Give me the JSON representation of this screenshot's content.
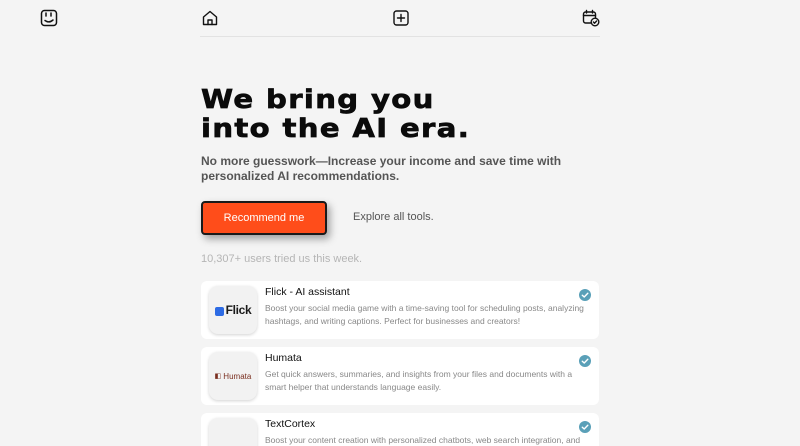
{
  "nav": {
    "logo_icon": "face-logo-icon",
    "items": [
      {
        "icon": "home-icon"
      },
      {
        "icon": "plus-square-icon"
      },
      {
        "icon": "calendar-check-icon"
      }
    ]
  },
  "hero": {
    "headline_line1": "We bring you",
    "headline_line2": "into the AI era.",
    "subheadline": "No more guesswork—Increase your income and save time with personalized AI recommendations.",
    "cta_label": "Recommend me",
    "explore_label": "Explore all tools.",
    "users_note": "10,307+ users tried us this week."
  },
  "tools": [
    {
      "name": "Flick - AI assistant",
      "logo_text": "Flick",
      "description": "Boost your social media game with a time-saving tool for scheduling posts, analyzing hashtags, and writing captions. Perfect for businesses and creators!",
      "verified": true
    },
    {
      "name": "Humata",
      "logo_text": "Humata",
      "description": "Get quick answers, summaries, and insights from your files and documents with a smart helper that understands language easily.",
      "verified": true
    },
    {
      "name": "TextCortex",
      "logo_text": "",
      "description": "Boost your content creation with personalized chatbots, web search integration, and",
      "verified": true
    }
  ],
  "colors": {
    "accent": "#ff4d1a",
    "verified": "#5aa0b8",
    "background": "#f4f4f4"
  }
}
